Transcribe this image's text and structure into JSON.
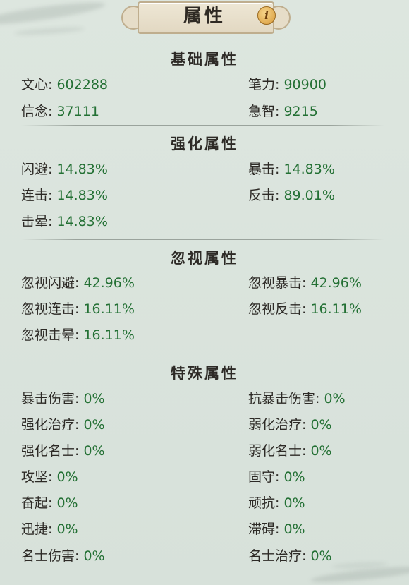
{
  "header": {
    "title": "属性",
    "info_icon": "info-icon"
  },
  "colors": {
    "label": "#2d2a26",
    "value": "#237034",
    "background": "#d9e3dc"
  },
  "sections": [
    {
      "title": "基础属性",
      "stats": [
        {
          "label": "文心",
          "value": "602288"
        },
        {
          "label": "笔力",
          "value": "90900"
        },
        {
          "label": "信念",
          "value": "37111"
        },
        {
          "label": "急智",
          "value": "9215"
        }
      ]
    },
    {
      "title": "强化属性",
      "stats": [
        {
          "label": "闪避",
          "value": "14.83%"
        },
        {
          "label": "暴击",
          "value": "14.83%"
        },
        {
          "label": "连击",
          "value": "14.83%"
        },
        {
          "label": "反击",
          "value": "89.01%"
        },
        {
          "label": "击晕",
          "value": "14.83%"
        }
      ]
    },
    {
      "title": "忽视属性",
      "stats": [
        {
          "label": "忽视闪避",
          "value": "42.96%"
        },
        {
          "label": "忽视暴击",
          "value": "42.96%"
        },
        {
          "label": "忽视连击",
          "value": "16.11%"
        },
        {
          "label": "忽视反击",
          "value": "16.11%"
        },
        {
          "label": "忽视击晕",
          "value": "16.11%"
        }
      ]
    },
    {
      "title": "特殊属性",
      "stats": [
        {
          "label": "暴击伤害",
          "value": "0%"
        },
        {
          "label": "抗暴击伤害",
          "value": "0%"
        },
        {
          "label": "强化治疗",
          "value": "0%"
        },
        {
          "label": "弱化治疗",
          "value": "0%"
        },
        {
          "label": "强化名士",
          "value": "0%"
        },
        {
          "label": "弱化名士",
          "value": "0%"
        },
        {
          "label": "攻坚",
          "value": "0%"
        },
        {
          "label": "固守",
          "value": "0%"
        },
        {
          "label": "奋起",
          "value": "0%"
        },
        {
          "label": "顽抗",
          "value": "0%"
        },
        {
          "label": "迅捷",
          "value": "0%"
        },
        {
          "label": "滞碍",
          "value": "0%"
        },
        {
          "label": "名士伤害",
          "value": "0%"
        },
        {
          "label": "名士治疗",
          "value": "0%"
        }
      ]
    }
  ]
}
